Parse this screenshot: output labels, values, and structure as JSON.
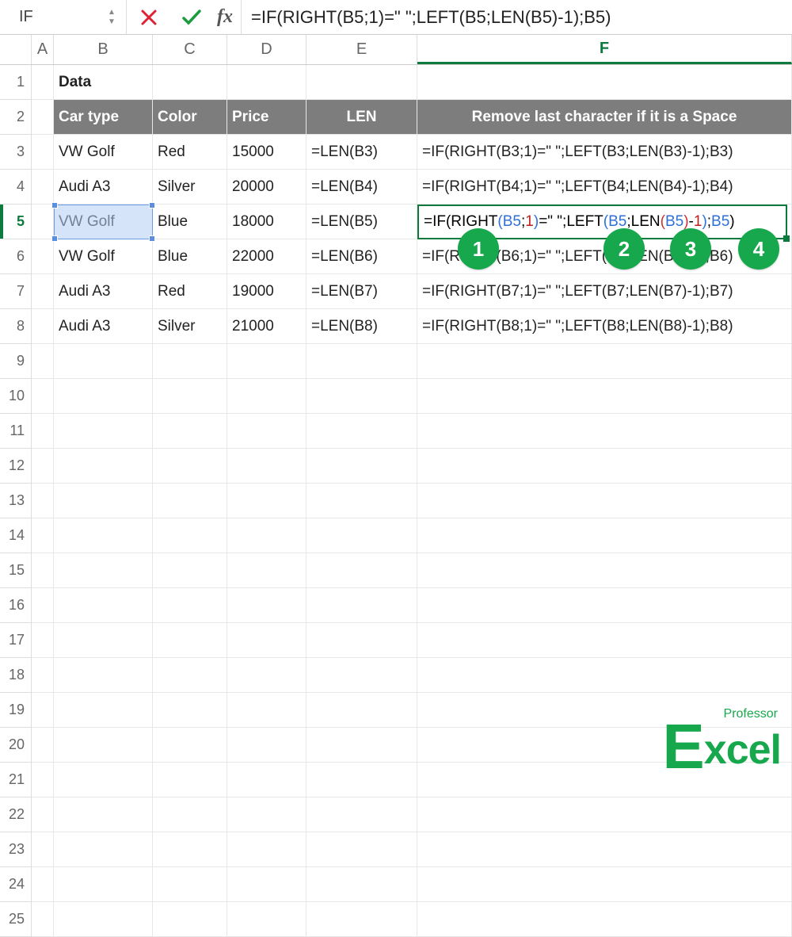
{
  "formula_bar": {
    "name_box": "IF",
    "fx_label": "fx",
    "formula": "=IF(RIGHT(B5;1)=\" \";LEFT(B5;LEN(B5)-1);B5)"
  },
  "columns": [
    "A",
    "B",
    "C",
    "D",
    "E",
    "F"
  ],
  "active_column": "F",
  "row_numbers": [
    1,
    2,
    3,
    4,
    5,
    6,
    7,
    8,
    9,
    10,
    11,
    12,
    13,
    14,
    15,
    16,
    17,
    18,
    19,
    20,
    21,
    22,
    23,
    24,
    25
  ],
  "active_row": 5,
  "title_cell": "Data",
  "headers": {
    "B": "Car type",
    "C": "Color",
    "D": "Price",
    "E": "LEN",
    "F": "Remove last character if it is a Space"
  },
  "rows": [
    {
      "B": "VW Golf",
      "C": "Red",
      "D": "15000",
      "E": "=LEN(B3)",
      "F": "=IF(RIGHT(B3;1)=\" \";LEFT(B3;LEN(B3)-1);B3)"
    },
    {
      "B": "Audi A3",
      "C": "Silver",
      "D": "20000",
      "E": "=LEN(B4)",
      "F": "=IF(RIGHT(B4;1)=\" \";LEFT(B4;LEN(B4)-1);B4)"
    },
    {
      "B": "VW Golf",
      "C": "Blue",
      "D": "18000",
      "E": "=LEN(B5)",
      "F": "=IF(RIGHT(B5;1)=\" \";LEFT(B5;LEN(B5)-1);B5)"
    },
    {
      "B": "VW Golf",
      "C": "Blue",
      "D": "22000",
      "E": "=LEN(B6)",
      "F": "=IF(RIGHT(B6;1)=\" \";LEFT(B6;LEN(B6)-1);B6)"
    },
    {
      "B": "Audi A3",
      "C": "Red",
      "D": "19000",
      "E": "=LEN(B7)",
      "F": "=IF(RIGHT(B7;1)=\" \";LEFT(B7;LEN(B7)-1);B7)"
    },
    {
      "B": "Audi A3",
      "C": "Silver",
      "D": "21000",
      "E": "=LEN(B8)",
      "F": "=IF(RIGHT(B8;1)=\" \";LEFT(B8;LEN(B8)-1);B8)"
    }
  ],
  "edit_cell_tokens": [
    "=IF(RIGHT",
    "(",
    "B5",
    ";",
    "1",
    ")",
    "=\" \";LEFT",
    "(",
    "B5",
    ";LEN",
    "(",
    "B5",
    ")",
    "-",
    "1",
    ")",
    ";",
    "B5",
    ")"
  ],
  "callouts": [
    "1",
    "2",
    "3",
    "4"
  ],
  "logo": {
    "brand": "Excel",
    "tag": "Professor"
  }
}
